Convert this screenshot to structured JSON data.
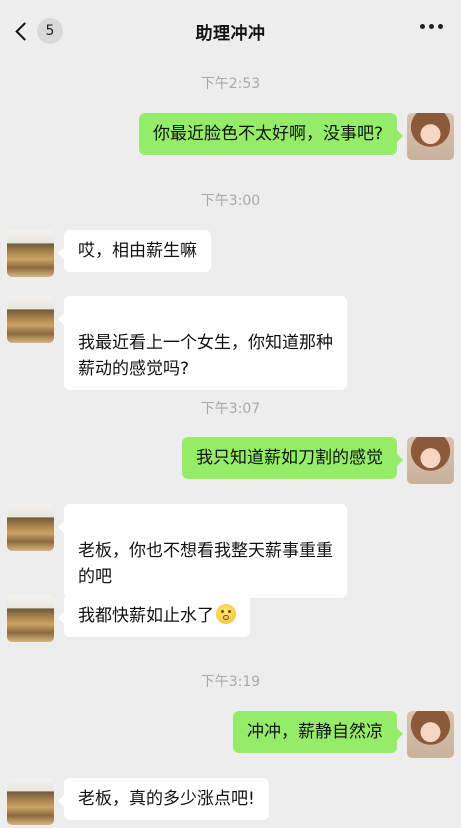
{
  "header": {
    "back_count": "5",
    "title": "助理冲冲",
    "back_icon": "chevron-left-icon",
    "more_icon": "more-dots-icon"
  },
  "times": [
    "下午2:53",
    "下午3:00",
    "下午3:07",
    "下午3:19"
  ],
  "messages": [
    {
      "side": "right",
      "text": "你最近脸色不太好啊，没事吧?"
    },
    {
      "side": "left",
      "text": "哎，相由薪生嘛"
    },
    {
      "side": "left",
      "text": "我最近看上一个女生，你知道那种\n薪动的感觉吗?"
    },
    {
      "side": "right",
      "text": "我只知道薪如刀割的感觉"
    },
    {
      "side": "left",
      "text": "老板，你也不想看我整天薪事重重\n的吧"
    },
    {
      "side": "left",
      "text": "我都快薪如止水了",
      "emoji": "dizzy-face-emoji"
    },
    {
      "side": "right",
      "text": "冲冲，薪静自然凉"
    },
    {
      "side": "left",
      "text": "老板，真的多少涨点吧!"
    }
  ],
  "colors": {
    "background": "#ededed",
    "self_bubble": "#95ec69",
    "other_bubble": "#ffffff",
    "timestamp": "#a8a8a8"
  }
}
